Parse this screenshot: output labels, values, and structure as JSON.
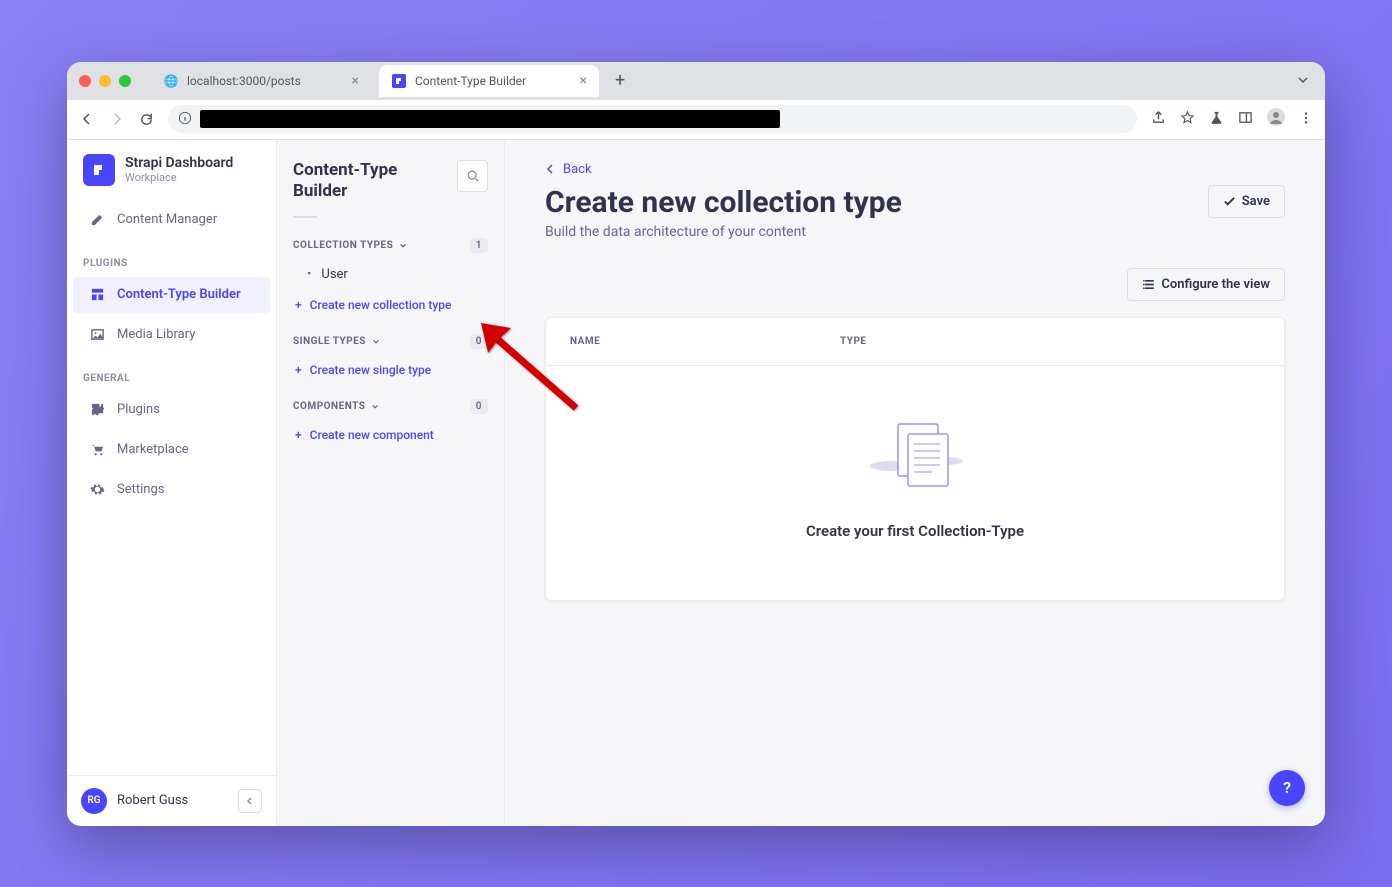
{
  "browser": {
    "tabs": [
      {
        "label": "localhost:3000/posts",
        "active": false
      },
      {
        "label": "Content-Type Builder",
        "active": true
      }
    ]
  },
  "sidebarLeft": {
    "brandTitle": "Strapi Dashboard",
    "brandSub": "Workplace",
    "itemsTop": [
      {
        "label": "Content Manager"
      }
    ],
    "pluginsLabel": "PLUGINS",
    "pluginsItems": [
      {
        "label": "Content-Type Builder",
        "active": true
      },
      {
        "label": "Media Library"
      }
    ],
    "generalLabel": "GENERAL",
    "generalItems": [
      {
        "label": "Plugins"
      },
      {
        "label": "Marketplace"
      },
      {
        "label": "Settings"
      }
    ],
    "userInitials": "RG",
    "userName": "Robert Guss"
  },
  "sidebarMid": {
    "title": "Content-Type Builder",
    "groups": {
      "collection": {
        "label": "COLLECTION TYPES",
        "count": "1",
        "items": [
          "User"
        ],
        "create": "Create new collection type"
      },
      "single": {
        "label": "SINGLE TYPES",
        "count": "0",
        "create": "Create new single type"
      },
      "components": {
        "label": "COMPONENTS",
        "count": "0",
        "create": "Create new component"
      }
    }
  },
  "main": {
    "back": "Back",
    "title": "Create new collection type",
    "subtitle": "Build the data architecture of your content",
    "saveLabel": "Save",
    "configureLabel": "Configure the view",
    "colName": "NAME",
    "colType": "TYPE",
    "emptyText": "Create your first Collection-Type"
  }
}
